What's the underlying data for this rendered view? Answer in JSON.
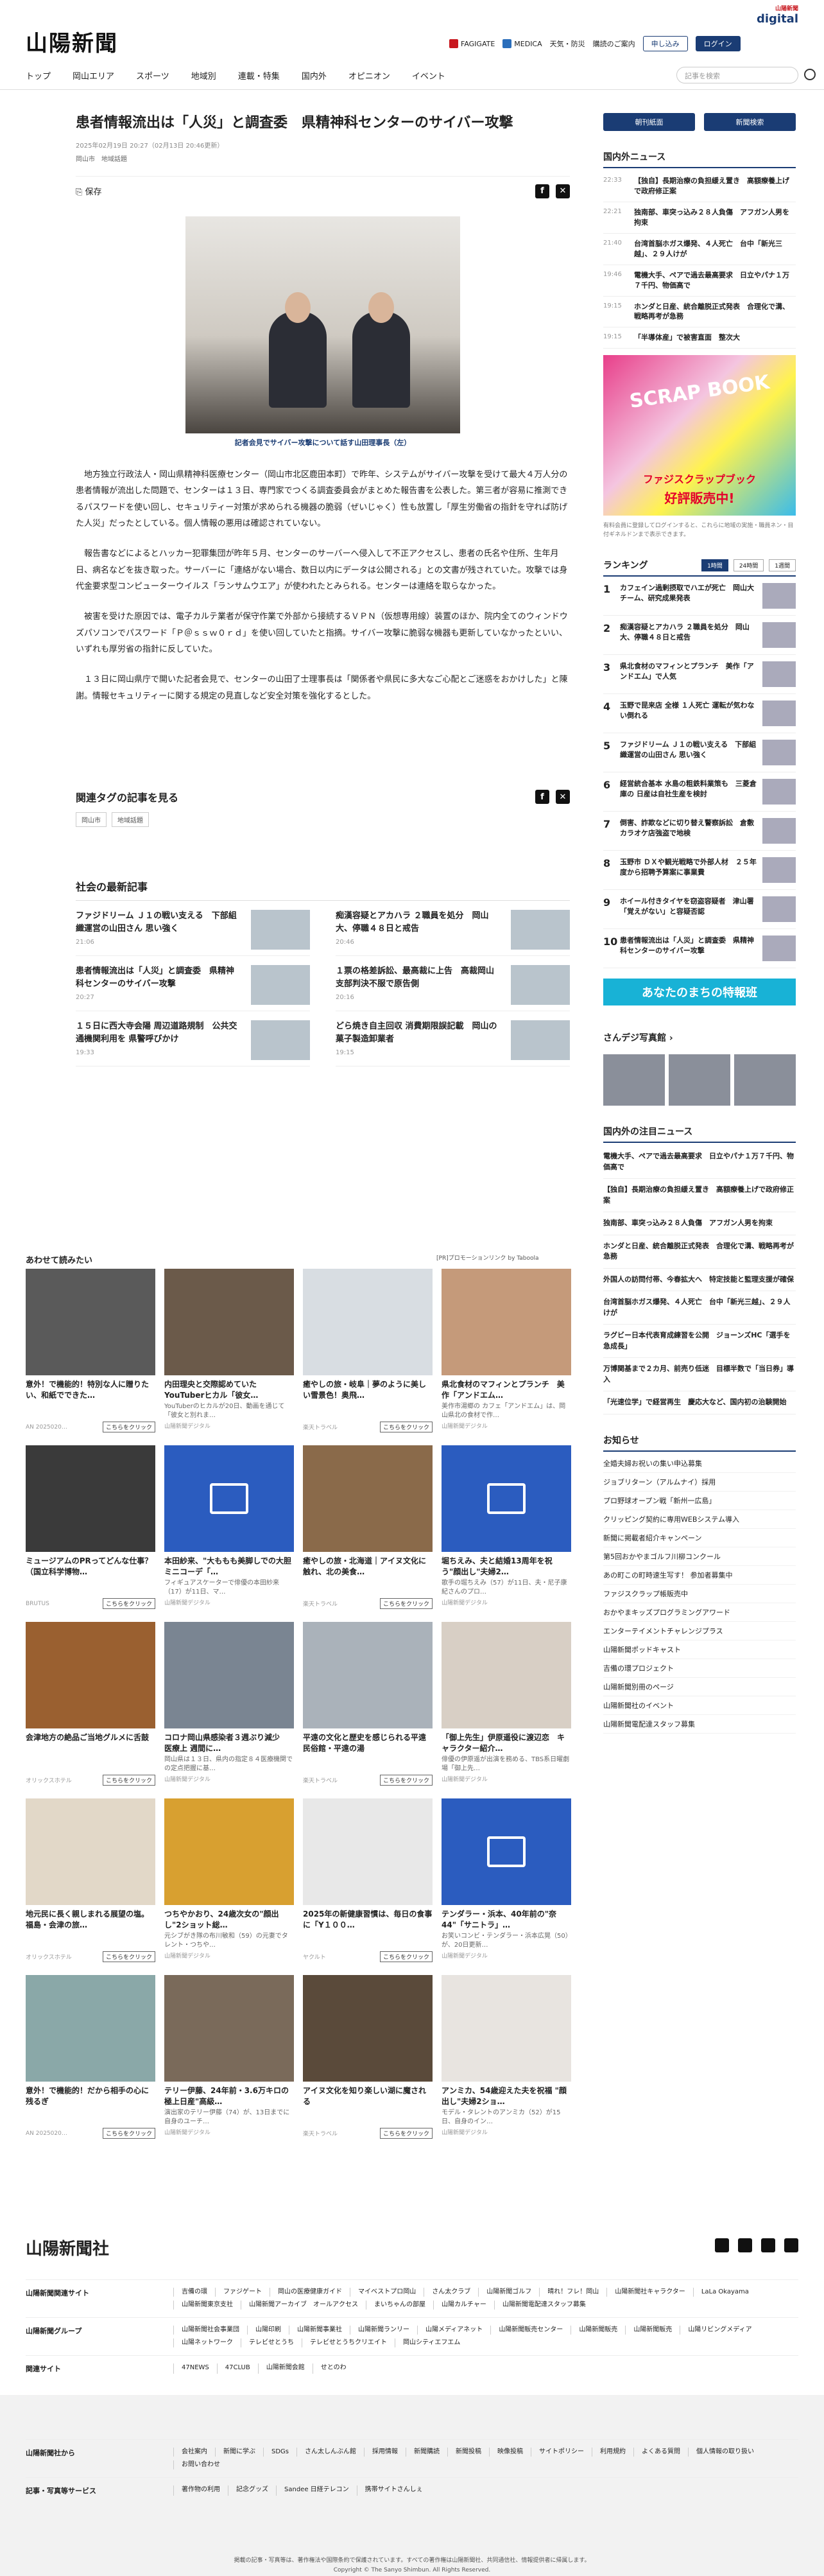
{
  "header": {
    "logo": "山陽新聞",
    "digital_small": "山陽新聞",
    "digital": "digital",
    "fagigate": "FAGIGATE",
    "medica": "MEDICA",
    "weather": "天気・防災",
    "subscribe_info": "購読のご案内",
    "apply": "申し込み",
    "login": "ログイン"
  },
  "nav": {
    "items": [
      "トップ",
      "岡山エリア",
      "スポーツ",
      "地域別",
      "連載・特集",
      "国内外",
      "オピニオン",
      "イベント"
    ],
    "search_placeholder": "記事を検索"
  },
  "article": {
    "title": "患者情報流出は「人災」と調査委　県精神科センターのサイバー攻撃",
    "date": "2025年02月19日 20:27（02月13日 20:46更新）",
    "tags": [
      "岡山市",
      "地域話題"
    ],
    "save": "保存",
    "caption": "記者会見でサイバー攻撃について話す山田理事長（左）",
    "paragraphs": [
      "地方独立行政法人・岡山県精神科医療センター（岡山市北区鹿田本町）で昨年、システムがサイバー攻撃を受けて最大４万人分の患者情報が流出した問題で、センターは１３日、専門家でつくる調査委員会がまとめた報告書を公表した。第三者が容易に推測できるパスワードを使い回し、セキュリティー対策が求められる機器の脆弱（ぜいじゃく）性も放置し「厚生労働省の指針を守れば防げた人災」だったとしている。個人情報の悪用は確認されていない。",
      "報告書などによるとハッカー犯罪集団が昨年５月、センターのサーバーへ侵入して不正アクセスし、患者の氏名や住所、生年月日、病名などを抜き取った。サーバーに「連絡がない場合、数日以内にデータは公開される」との文書が残されていた。攻撃では身代金要求型コンピューターウイルス「ランサムウエア」が使われたとみられる。センターは連絡を取らなかった。",
      "被害を受けた原因では、電子カルテ業者が保守作業で外部から接続するＶＰＮ（仮想専用線）装置のほか、院内全てのウィンドウズパソコンでパスワード「Ｐ＠ｓｓｗ０ｒｄ」を使い回していたと指摘。サイバー攻撃に脆弱な機器も更新していなかったといい、いずれも厚労省の指針に反していた。",
      "１３日に岡山県庁で開いた記者会見で、センターの山田了士理事長は「関係者や県民に多大なご心配とご迷惑をおかけした」と陳謝。情報セキュリティーに関する規定の見直しなど安全対策を強化するとした。"
    ]
  },
  "related": {
    "heading": "関連タグの記事を見る",
    "tags": [
      "岡山市",
      "地域話題"
    ]
  },
  "social": {
    "heading": "社会の最新記事",
    "items": [
      {
        "title": "ファジドリーム Ｊ１の戦い支える　下部組織運営の山田さん 思い強く",
        "time": "21:06"
      },
      {
        "title": "痴漢容疑とアカハラ ２職員を処分　岡山大、停職４８日と戒告",
        "time": "20:46"
      },
      {
        "title": "患者情報流出は「人災」と調査委　県精神科センターのサイバー攻撃",
        "time": "20:27"
      },
      {
        "title": "１票の格差訴訟、最高裁に上告　高裁岡山支部判決不服で原告側",
        "time": "20:16"
      },
      {
        "title": "１５日に西大寺会陽 周辺道路規制　公共交通機関利用を 県警呼びかけ",
        "time": "19:33"
      },
      {
        "title": "どら焼き自主回収 消費期限誤記載　岡山の菓子製造卸業者",
        "time": "19:15"
      }
    ]
  },
  "recommend": {
    "heading": "あわせて読みたい",
    "pr": "[PR]プロモーションリンク by Taboola",
    "cta": "こちらをクリック",
    "cards": [
      {
        "title": "意外！で機能的！特別な人に贈りたい、和紙でできた…",
        "desc": "",
        "src": "AN 2025020…",
        "cta": true,
        "tone": "#5a5a5a"
      },
      {
        "title": "内田理央と交際認めていたYouTuberヒカル「彼女…",
        "desc": "YouTuberのヒカルが20日、動画を通じて「彼女と別れま…",
        "src": "山陽新聞デジタル",
        "cta": false,
        "tone": "#6b5a4a"
      },
      {
        "title": "癒やしの旅・岐阜｜夢のように美しい雪景色！奥飛…",
        "desc": "",
        "src": "楽天トラベル",
        "cta": true,
        "tone": "#d8dde2"
      },
      {
        "title": "県北食材のマフィンとプランチ　美作「アンドエム…",
        "desc": "美作市湯郷の カフェ「アンドエム」は、岡山県北の食材で作…",
        "src": "山陽新聞デジタル",
        "cta": false,
        "tone": "#c59a7a"
      },
      {
        "title": "ミュージアムのPRってどんな仕事？（国立科学博物…",
        "desc": "",
        "src": "BRUTUS",
        "cta": true,
        "tone": "#3a3a3a"
      },
      {
        "title": "本田紗来、\"大ももも美脚しでの大胆ミニコーデ「…",
        "desc": "フィギュアスケーターで俳優の本田紗来（17）が11日、マ…",
        "src": "山陽新聞デジタル",
        "cta": false,
        "tone": "icon"
      },
      {
        "title": "癒やしの旅・北海道｜アイヌ文化に触れ、北の美食…",
        "desc": "",
        "src": "楽天トラベル",
        "cta": true,
        "tone": "#8a6a4a"
      },
      {
        "title": "堀ちえみ、夫と結婚13周年を祝う\"顔出し\"夫婦2…",
        "desc": "歌手の堀ちえみ（57）が11日、夫・尼子康紀さんのプロ…",
        "src": "山陽新聞デジタル",
        "cta": false,
        "tone": "icon"
      },
      {
        "title": "会津地方の絶品ご当地グルメに舌鼓",
        "desc": "",
        "src": "オリックスホテル",
        "cta": true,
        "tone": "#9a6030"
      },
      {
        "title": "コロナ岡山県感染者３週ぶり減少　医療上 週間に…",
        "desc": "岡山県は１３日、県内の指定８４医療機関での定点把握に基…",
        "src": "山陽新聞デジタル",
        "cta": false,
        "tone": "#7a8592"
      },
      {
        "title": "平遠の文化と歴史を感じられる平遠民俗館・平遠の湯",
        "desc": "",
        "src": "楽天トラベル",
        "cta": true,
        "tone": "#aab2ba"
      },
      {
        "title": "「御上先生」伊原遥役に渡辺恋　キャラクター紹介…",
        "desc": "俳優の伊原遥が出演を務める、TBS系日曜劇場「御上先…",
        "src": "山陽新聞デジタル",
        "cta": false,
        "tone": "#d8cfc5"
      },
      {
        "title": "地元民に長く親しまれる展望の塩。福島・会津の旅…",
        "desc": "",
        "src": "オリックスホテル",
        "cta": true,
        "tone": "#e2d8c8"
      },
      {
        "title": "つちやかおり、24歳次女の\"顔出し\"2ショット総…",
        "desc": "元シブがき隊の布川敏和（59）の元妻でタレント・つちや…",
        "src": "山陽新聞デジタル",
        "cta": false,
        "tone": "#d8a030"
      },
      {
        "title": "2025年の新健康習慣は、毎日の食事に「Y１００…",
        "desc": "",
        "src": "ヤクルト",
        "cta": true,
        "tone": "#e8e8e8"
      },
      {
        "title": "テンダラー・浜本、40年前の\"奈 44\"「サニトラ」…",
        "desc": "お笑いコンビ・テンダラー・浜本広晃（50）が、20日更新…",
        "src": "山陽新聞デジタル",
        "cta": false,
        "tone": "icon"
      },
      {
        "title": "意外！で機能的！だから相手の心に残るぎ",
        "desc": "",
        "src": "AN 2025020…",
        "cta": true,
        "tone": "#8aa8a8"
      },
      {
        "title": "テリー伊藤、24年前・3.6万キロの極上日産\"高級…",
        "desc": "演出家のテリー伊藤（74）が、13日までに自身のユーチ…",
        "src": "山陽新聞デジタル",
        "cta": false,
        "tone": "#7a6a5a"
      },
      {
        "title": "アイヌ文化を知り楽しい湖に魔される",
        "desc": "",
        "src": "楽天トラベル",
        "cta": true,
        "tone": "#5a4a3a"
      },
      {
        "title": "アンミカ、54歳迎えた夫を祝福 \"顔出し\"夫婦2ショ…",
        "desc": "モデル・タレントのアンミカ（52）が15日、自身のイン…",
        "src": "山陽新聞デジタル",
        "cta": false,
        "tone": "#e8e4e0"
      }
    ]
  },
  "sidebar": {
    "btn_paper": "朝刊紙面",
    "btn_reader": "新聞検索",
    "news_heading": "国内外ニュース",
    "news": [
      {
        "time": "22:33",
        "title": "【独自】長期治療の負担緩え置き　高額療養上げで政府修正案"
      },
      {
        "time": "22:21",
        "title": "独南部、車突っ込み２８人負傷　アフガン人男を拘束"
      },
      {
        "time": "21:40",
        "title": "台湾首脳ホガス爆発、４人死亡　台中「新光三越」、２９人けが"
      },
      {
        "time": "19:46",
        "title": "電機大手、ペアで過去最高要求　日立やパナ１万７千円、物価高で"
      },
      {
        "time": "19:15",
        "title": "ホンダと日産、統合離脱正式発表　合理化で溝、戦略再考が急務"
      },
      {
        "time": "19:15",
        "title": "「半導体産」で被害直面　整次大"
      }
    ],
    "ad_top": "SCRAP BOOK",
    "ad_text": "好評販売中!",
    "ad_sub": "ファジスクラップブック",
    "note": "有料会員に登録してログインすると、これらに地域の実施・職員ネン・目付ギネルドンまで表示できます。",
    "rank_heading": "ランキング",
    "rank_tabs": [
      "1時間",
      "24時間",
      "1週間"
    ],
    "ranking": [
      "カフェイン過剰摂取でハエが死亡　岡山大チーム、研究成果発表",
      "痴漢容疑とアカハラ ２職員を処分　岡山大、停職４８日と戒告",
      "県北食材のマフィンとプランチ　美作「アンドエム」で人気",
      "玉野で昆来店 全様 １人死亡 運転が気わない倒れる",
      "ファジドリーム Ｊ１の戦い支える　下部組織運営の山田さん 思い強く",
      "経営統合基本 水島の粗鉄料業策も　三菱倉庫の 日産は自社生産を検討",
      "倒害、詐欺などに切り替え警察訴訟　倉敷カラオケ店強盗で地検",
      "玉野市 ＤＸや観光戦略で外部人材　２５年度から招聘予算案に事業費",
      "ホイール付きタイヤを窃盗容疑者　津山署「覚えがない」と容疑否認",
      "患者情報流出は「人災」と調査委　県精神科センターのサイバー攻撃"
    ],
    "tokuban": "あなたのまちの特報班",
    "photo_heading": "さんデジ写真館",
    "attention_heading": "国内外の注目ニュース",
    "attention": [
      "電機大手、ペアで過去最高要求　日立やパナ１万７千円、物価高で",
      "【独自】長期治療の負担緩え置き　高額療養上げで政府修正案",
      "独南部、車突っ込み２８人負傷　アフガン人男を拘束",
      "ホンダと日産、統合離脱正式発表　合理化で溝、戦略再考が急務",
      "外国人の訪問付帯、今春拡大へ　特定技能と監理支援が確保",
      "台湾首脳ホガス爆発、４人死亡　台中「新光三越」、２９人けが",
      "ラグビー日本代表育成練習を公開　ジョーンズHC「選手を急成長」",
      "万博関基まで２カ月、前売り低迷　目標半数で「当日券」導入",
      "「光速位学」で経営再生　慶応大など、国内初の治験開始"
    ],
    "info_heading": "お知らせ",
    "info": [
      "全婚夫婦お祝いの集い申込募集",
      "ジョブリターン（アルムナイ）採用",
      "プロ野球オープン戦「新州一広島」",
      "クリッピング契約に専用WEBシステム導入",
      "新聞に掲載者紹介キャンペーン",
      "第5回おかやまゴルフ川柳コンクール",
      "あの町この町時速生写す！ 参加者募集中",
      "ファジスクラップ帳販売中",
      "おかやまキッズプログラミングアワード",
      "エンターテイメントチャレンジプラス",
      "山陽新聞ポッドキャスト",
      "吉備の環プロジェクト",
      "山陽新聞別冊のページ",
      "山陽新聞社のイベント",
      "山陽新聞電配達スタッフ募集"
    ]
  },
  "footer": {
    "logo": "山陽新聞社",
    "rows": [
      {
        "key": "山陽新聞関連サイト",
        "vals": [
          "吉備の環",
          "ファジゲート",
          "岡山の医療健康ガイド",
          "マイベストプロ岡山",
          "さん太クラブ",
          "山陽新聞ゴルフ",
          "晴れ！フレ！岡山",
          "山陽新聞社キャラクター",
          "LaLa Okayama",
          "山陽新聞東京支社",
          "山陽新聞アーカイブ　オールアクセス",
          "まいちゃんの部屋",
          "山陽カルチャー",
          "山陽新聞電配達スタッフ募集"
        ]
      },
      {
        "key": "山陽新聞グループ",
        "vals": [
          "山陽新聞社会事業団",
          "山陽印刷",
          "山陽新聞事業社",
          "山陽新聞ランリー",
          "山陽メディアネット",
          "山陽新聞販売センター",
          "山陽新聞販売",
          "山陽新聞販売",
          "山陽リビングメディア",
          "山陽ネットワーク",
          "テレビせとうち",
          "テレビせとうちクリエイト",
          "岡山シティエフエム"
        ]
      },
      {
        "key": "関連サイト",
        "vals": [
          "47NEWS",
          "47CLUB",
          "山陽新聞会館",
          "せとのわ"
        ]
      },
      {
        "key": "山陽新聞社から",
        "vals": [
          "会社案内",
          "新聞に学ぶ",
          "SDGs",
          "さん太しんぶん館",
          "採用情報",
          "新聞購読",
          "新聞投稿",
          "映像投稿",
          "サイトポリシー",
          "利用規約",
          "よくある質問",
          "個人情報の取り扱い",
          "お問い合わせ"
        ]
      },
      {
        "key": "記事・写真等サービス",
        "vals": [
          "著作物の利用",
          "記念グッズ",
          "Sandee 日経テレコン",
          "携帯サイトさんしぇ"
        ]
      }
    ],
    "notice": "掲載の記事・写真等は、著作権法や国際条約で保護されています。すべての著作権は山陽新聞社、共同通信社、情報提供者に帰属します。",
    "copyright": "Copyright © The Sanyo Shimbun. All Rights Reserved."
  }
}
